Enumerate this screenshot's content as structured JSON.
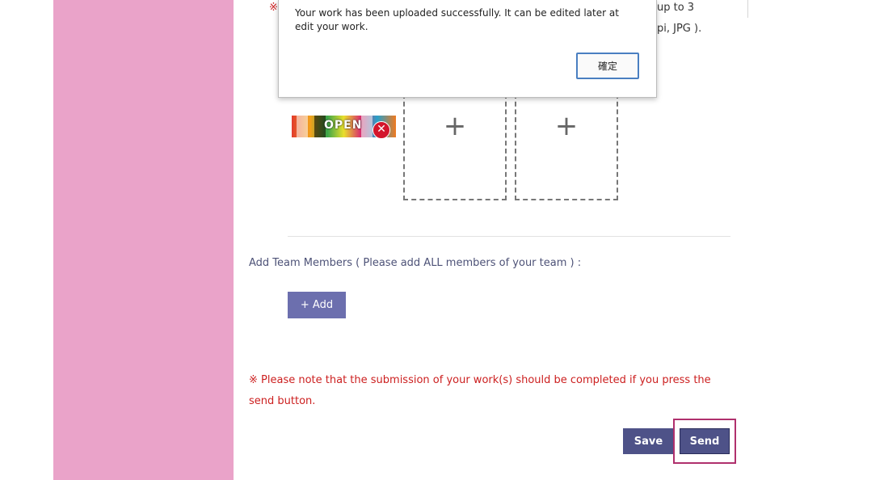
{
  "background_note": {
    "mark": "※",
    "tail_line1": "up to 3",
    "tail_line2": "pi, JPG )."
  },
  "thumbnail": {
    "label": "OPEN",
    "remove_icon": "close-circle-icon"
  },
  "upload_slots": [
    {
      "icon": "plus-icon",
      "glyph": "+"
    },
    {
      "icon": "plus-icon",
      "glyph": "+"
    }
  ],
  "team": {
    "label": "Add Team Members ( Please add ALL members of your team ) :",
    "add_button": "+ Add"
  },
  "warning": {
    "text": "※ Please note that the submission of your work(s) should be completed if you press the send button."
  },
  "actions": {
    "save": "Save",
    "send": "Send"
  },
  "alert": {
    "message": "Your work has been uploaded successfully. It can be edited later at edit your work.",
    "ok_label": "確定"
  },
  "colors": {
    "sidebar": "#eaa3c9",
    "button": "#4e5288",
    "add_button": "#6c6fae",
    "warning_text": "#cc1f1f",
    "highlight": "#b0306d"
  }
}
